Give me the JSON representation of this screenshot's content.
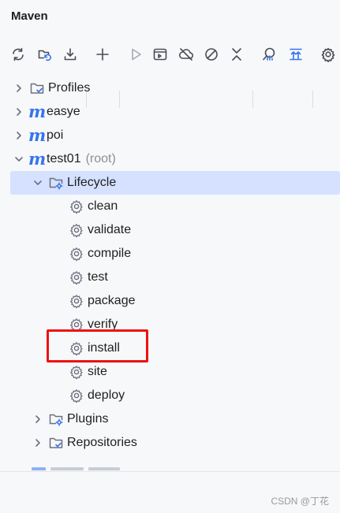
{
  "panel": {
    "title": "Maven"
  },
  "toolbar": {
    "buttons": [
      {
        "icon": "reload-icon",
        "state": "on"
      },
      {
        "icon": "reload-folders-icon",
        "state": "on"
      },
      {
        "icon": "download-icon",
        "state": "on"
      },
      {
        "icon": "add-icon",
        "state": "on"
      },
      {
        "icon": "run-icon",
        "state": "off"
      },
      {
        "icon": "run-config-icon",
        "state": "on"
      },
      {
        "icon": "offline-mode-icon",
        "state": "on"
      },
      {
        "icon": "skip-tests-icon",
        "state": "on"
      },
      {
        "icon": "collapse-all-icon",
        "state": "on"
      },
      {
        "icon": "analyze-dependencies-icon",
        "state": "on"
      },
      {
        "icon": "show-structure-icon",
        "state": "on"
      },
      {
        "icon": "settings-icon",
        "state": "on"
      }
    ]
  },
  "tree": {
    "profiles": "Profiles",
    "projects": [
      {
        "name": "easye"
      },
      {
        "name": "poi"
      },
      {
        "name": "test01",
        "suffix": "(root)"
      }
    ],
    "lifecycle": {
      "label": "Lifecycle",
      "phases": [
        "clean",
        "validate",
        "compile",
        "test",
        "package",
        "verify",
        "install",
        "site",
        "deploy"
      ]
    },
    "plugins": "Plugins",
    "repositories": "Repositories"
  },
  "watermark": "CSDN @丁花",
  "colors": {
    "accent": "#3574f0",
    "selection": "#d5e1ff",
    "highlight_box": "#ee1111",
    "background": "#f7f8fa"
  }
}
